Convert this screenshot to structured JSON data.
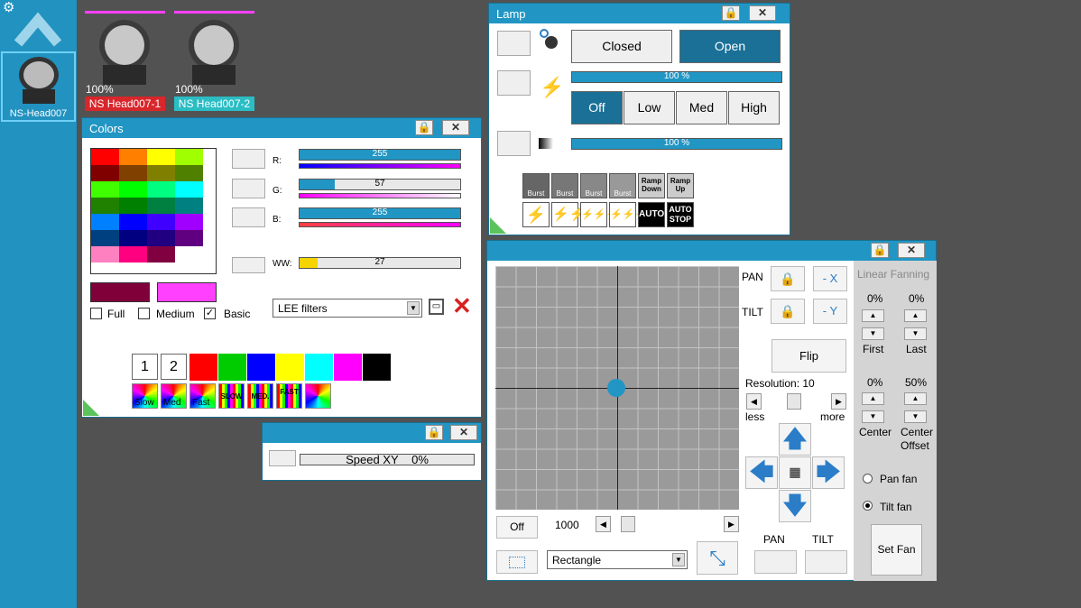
{
  "sidebar": {
    "fixture_label": "NS-Head007"
  },
  "fixtures": [
    {
      "percent": "100%",
      "name": "NS Head007-1",
      "color": "#d8262b"
    },
    {
      "percent": "100%",
      "name": "NS Head007-2",
      "color": "#2bbdc4"
    }
  ],
  "colors_panel": {
    "title": "Colors",
    "r_label": "R:",
    "r_value": "255",
    "r_fraction": 1.0,
    "g_label": "G:",
    "g_value": "57",
    "g_fraction": 0.22,
    "b_label": "B:",
    "b_value": "255",
    "b_fraction": 1.0,
    "ww_label": "WW:",
    "ww_value": "27",
    "ww_fraction": 0.11,
    "full_label": "Full",
    "medium_label": "Medium",
    "basic_label": "Basic",
    "filter_select": "LEE filters",
    "preset_1": "1",
    "preset_2": "2",
    "slow_label": "Slow",
    "med_label": "Med",
    "fast_label": "Fast",
    "slow_caps": "SLOW",
    "med_caps": "MED.",
    "fast_caps": "FAST",
    "palette": [
      "#ff0000",
      "#ff8000",
      "#ffff00",
      "#a0ff00",
      "#800000",
      "#804000",
      "#808000",
      "#508000",
      "#40ff00",
      "#00ff00",
      "#00ff80",
      "#00ffff",
      "#208000",
      "#008000",
      "#008040",
      "#008080",
      "#0080ff",
      "#0000ff",
      "#4000ff",
      "#a000ff",
      "#004080",
      "#000080",
      "#200080",
      "#600080",
      "#ff80c0",
      "#ff0080",
      "#800040",
      "#ffffff"
    ],
    "current_color": "#80003a",
    "next_color": "#ff40ff",
    "quick_colors": [
      "#ff0000",
      "#00cc00",
      "#0000ff",
      "#ffff00",
      "#00ffff",
      "#ff00ff",
      "#000000"
    ]
  },
  "speed_panel": {
    "label": "Speed XY",
    "value": "0%"
  },
  "lamp_panel": {
    "title": "Lamp",
    "closed_label": "Closed",
    "open_label": "Open",
    "dimmer_value": "100 %",
    "off_label": "Off",
    "low_label": "Low",
    "med_label": "Med",
    "high_label": "High",
    "intensity_value": "100 %",
    "burst_label": "Burst",
    "ramp_down": "Ramp Down",
    "ramp_up": "Ramp Up",
    "auto_label": "AUTO",
    "auto_stop": "AUTO STOP"
  },
  "movement_panel": {
    "pan_label": "PAN",
    "tilt_label": "TILT",
    "minus_x": "- X",
    "minus_y": "- Y",
    "flip_label": "Flip",
    "resolution_label": "Resolution: 10",
    "less_label": "less",
    "more_label": "more",
    "off_label": "Off",
    "speed_value": "1000",
    "shape_select": "Rectangle",
    "pan_bottom": "PAN",
    "tilt_bottom": "TILT",
    "fanning_title": "Linear Fanning",
    "first_pct": "0%",
    "last_pct": "0%",
    "first_label": "First",
    "last_label": "Last",
    "center_pct": "0%",
    "center_offset_pct": "50%",
    "center_label": "Center",
    "center_offset_label": "Center Offset",
    "pan_fan_label": "Pan fan",
    "tilt_fan_label": "Tilt fan",
    "set_fan_label": "Set Fan",
    "accent": "#2196c4"
  },
  "icons": {
    "lock": "🔒",
    "close": "✕"
  }
}
